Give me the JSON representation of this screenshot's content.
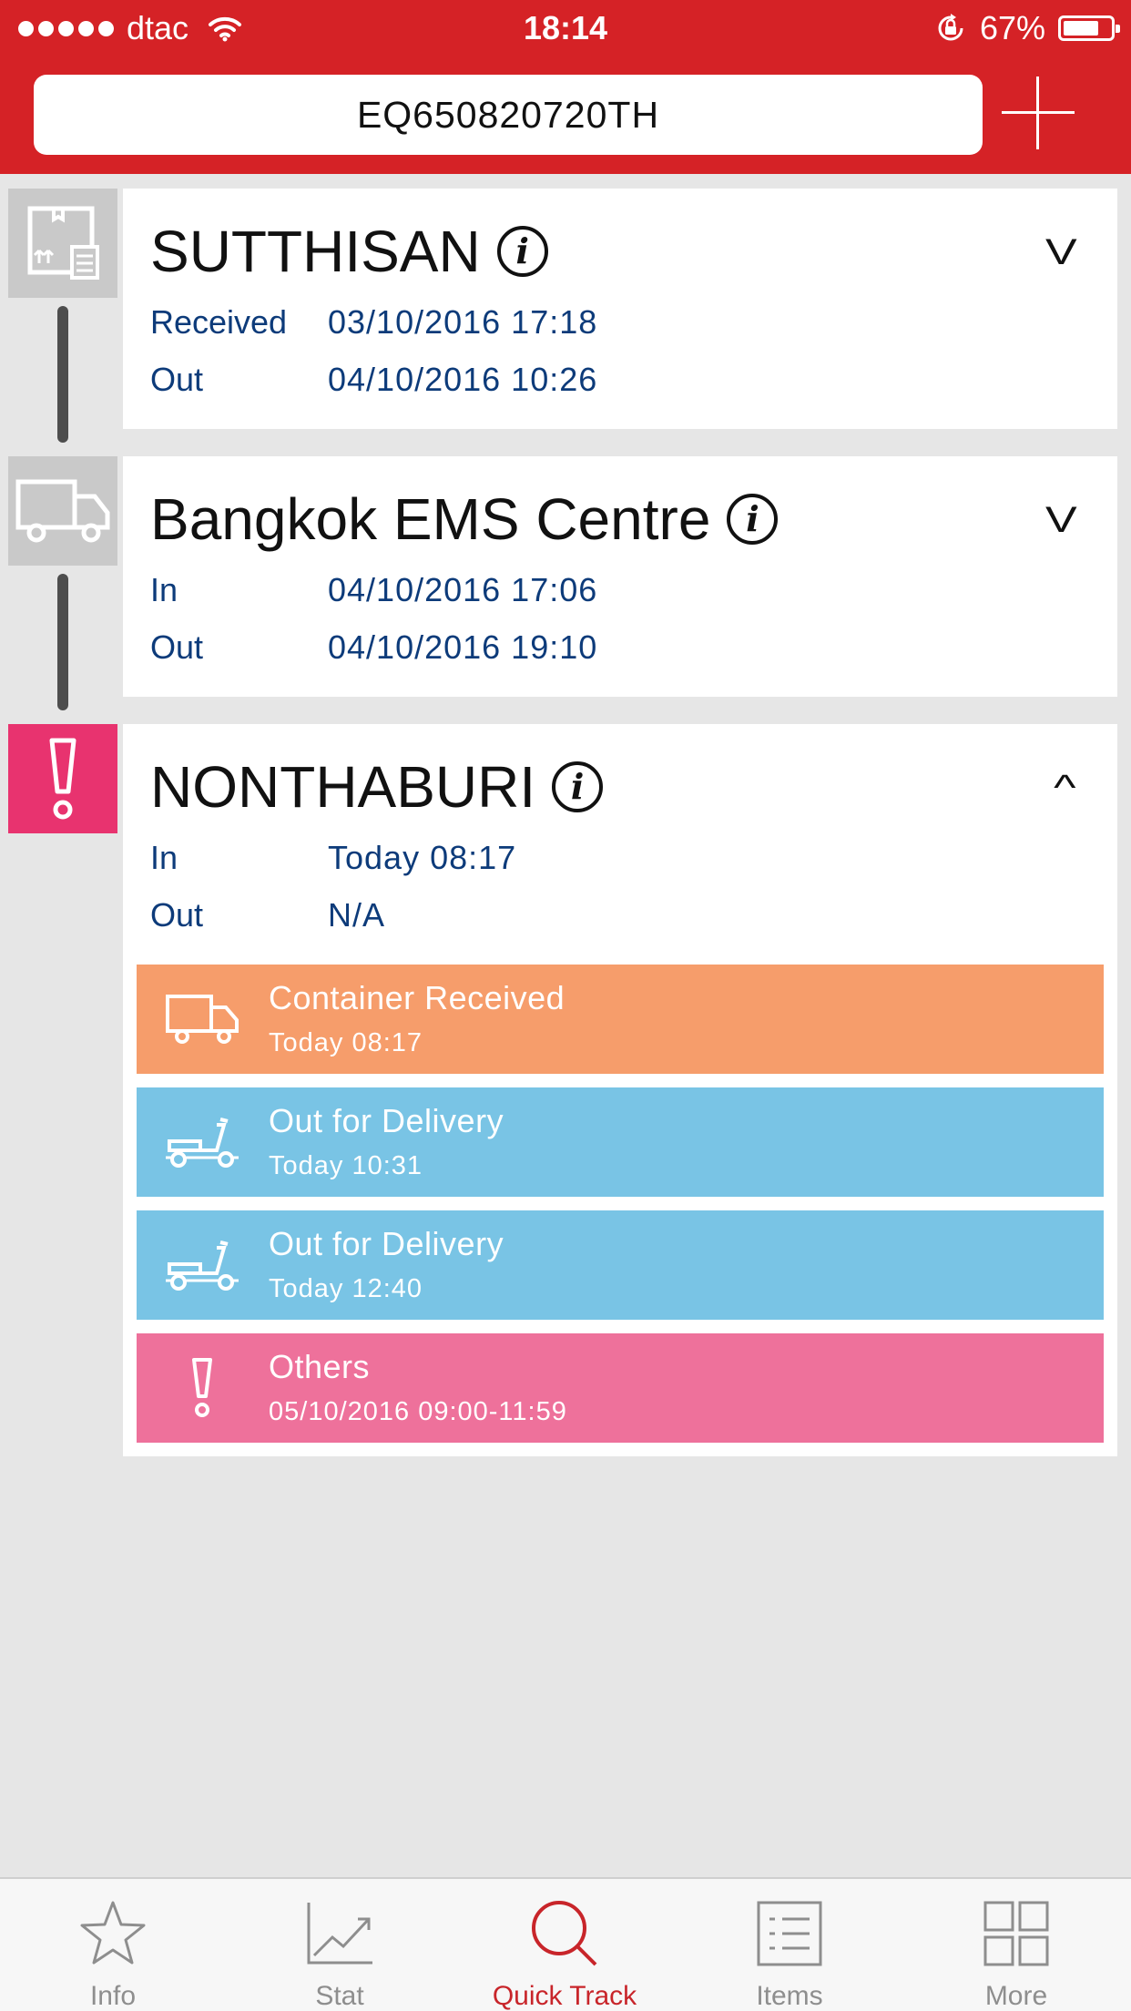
{
  "status_bar": {
    "carrier": "dtac",
    "time": "18:14",
    "battery": "67%",
    "battery_level": 0.67
  },
  "search": {
    "tracking_number": "EQ650820720TH"
  },
  "locations": [
    {
      "name": "SUTTHISAN",
      "status_icon": "parcel-box-icon",
      "rows": [
        {
          "label": "Received",
          "value": "03/10/2016 17:18"
        },
        {
          "label": "Out",
          "value": "04/10/2016 10:26"
        }
      ],
      "chevron": "V",
      "expanded": false
    },
    {
      "name": "Bangkok EMS Centre",
      "status_icon": "truck-icon",
      "rows": [
        {
          "label": "In",
          "value": "04/10/2016 17:06"
        },
        {
          "label": "Out",
          "value": "04/10/2016 19:10"
        }
      ],
      "chevron": "V",
      "expanded": false
    },
    {
      "name": "NONTHABURI",
      "status_icon": "exclamation-icon",
      "rows": [
        {
          "label": "In",
          "value": "Today 08:17"
        },
        {
          "label": "Out",
          "value": "N/A"
        }
      ],
      "chevron": "^",
      "expanded": true,
      "events": [
        {
          "title": "Container Received",
          "time": "Today 08:17",
          "icon": "truck-icon",
          "color": "#f69d6b"
        },
        {
          "title": "Out for Delivery",
          "time": "Today 10:31",
          "icon": "scooter-icon",
          "color": "#79c4e5"
        },
        {
          "title": "Out for Delivery",
          "time": "Today 12:40",
          "icon": "scooter-icon",
          "color": "#79c4e5"
        },
        {
          "title": "Others",
          "time": "05/10/2016 09:00-11:59",
          "icon": "exclamation-icon",
          "color": "#ee719b"
        }
      ]
    }
  ],
  "tabs": [
    {
      "label": "Info",
      "icon": "star-icon",
      "active": false
    },
    {
      "label": "Stat",
      "icon": "chart-icon",
      "active": false
    },
    {
      "label": "Quick Track",
      "icon": "search-icon",
      "active": true
    },
    {
      "label": "Items",
      "icon": "list-icon",
      "active": false
    },
    {
      "label": "More",
      "icon": "grid-icon",
      "active": false
    }
  ],
  "colors": {
    "header": "#d52226",
    "accent": "#c8252a",
    "row_text": "#0d3b7a",
    "alert": "#e8336f"
  }
}
